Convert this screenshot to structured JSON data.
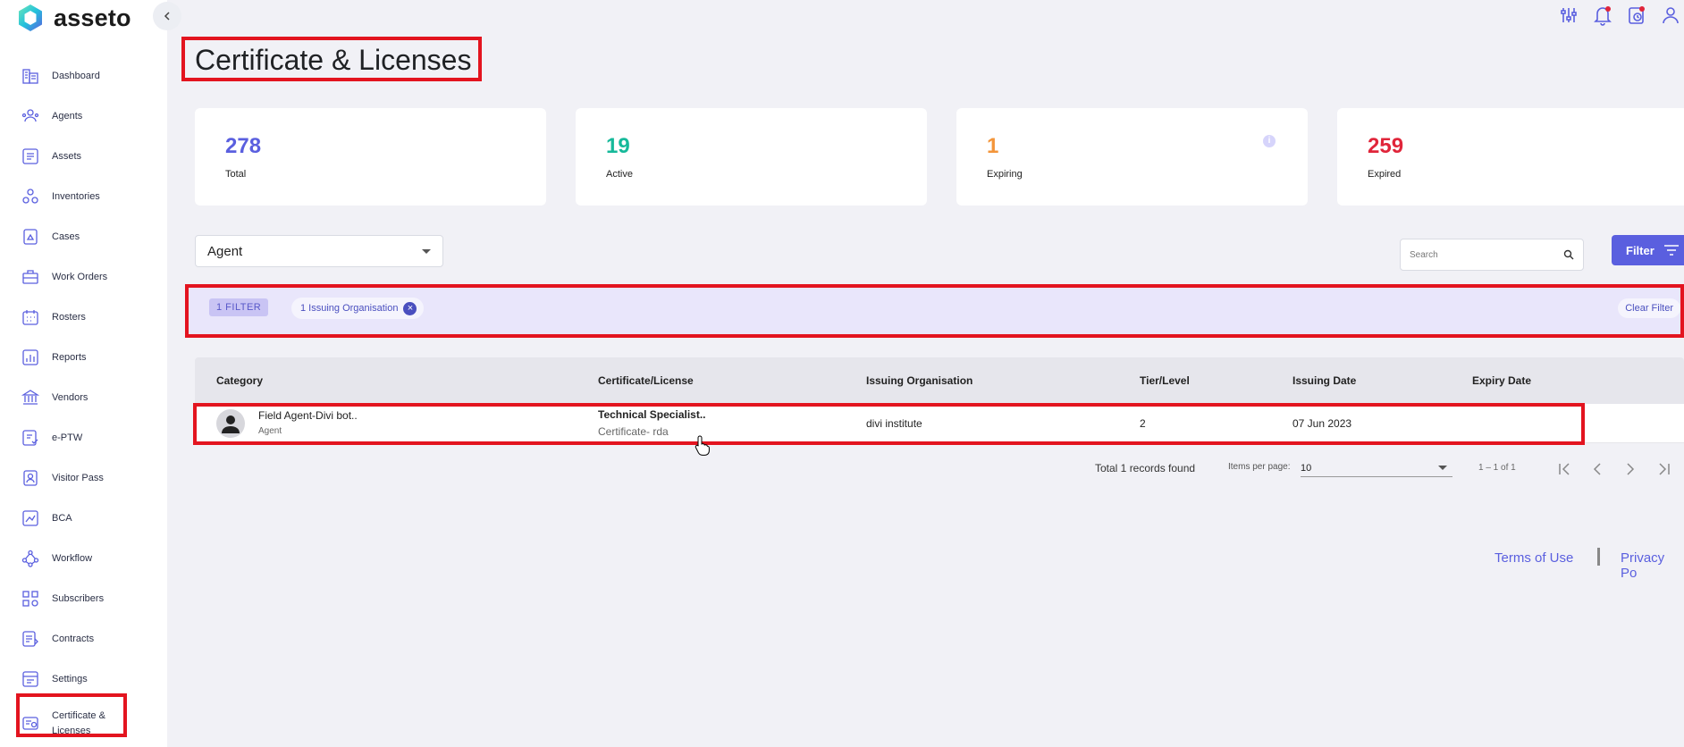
{
  "app": {
    "name": "asseto"
  },
  "sidebar": {
    "items": [
      {
        "label": "Dashboard",
        "icon": "building-icon"
      },
      {
        "label": "Agents",
        "icon": "agents-icon"
      },
      {
        "label": "Assets",
        "icon": "assets-icon"
      },
      {
        "label": "Inventories",
        "icon": "inventories-icon"
      },
      {
        "label": "Cases",
        "icon": "cases-icon"
      },
      {
        "label": "Work Orders",
        "icon": "toolbox-icon"
      },
      {
        "label": "Rosters",
        "icon": "calendar-icon"
      },
      {
        "label": "Reports",
        "icon": "bar-chart-icon"
      },
      {
        "label": "Vendors",
        "icon": "bank-icon"
      },
      {
        "label": "e-PTW",
        "icon": "permit-icon"
      },
      {
        "label": "Visitor Pass",
        "icon": "badge-icon"
      },
      {
        "label": "BCA",
        "icon": "bca-icon"
      },
      {
        "label": "Workflow",
        "icon": "workflow-icon"
      },
      {
        "label": "Subscribers",
        "icon": "grid-icon"
      },
      {
        "label": "Contracts",
        "icon": "contract-icon"
      },
      {
        "label": "Settings",
        "icon": "settings-icon"
      },
      {
        "label": "Certificate & Licenses",
        "icon": "certificate-icon"
      }
    ]
  },
  "header": {
    "title": "Certificate & Licenses"
  },
  "stats": [
    {
      "value": "278",
      "label": "Total",
      "color": "#5a5fdf"
    },
    {
      "value": "19",
      "label": "Active",
      "color": "#16b99a"
    },
    {
      "value": "1",
      "label": "Expiring",
      "color": "#f3953a"
    },
    {
      "value": "259",
      "label": "Expired",
      "color": "#e0253a"
    }
  ],
  "controls": {
    "category_select": "Agent",
    "search_placeholder": "Search",
    "filter_label": "Filter"
  },
  "filter_bar": {
    "count_label": "1 FILTER",
    "chip_label": "1 Issuing Organisation",
    "clear_label": "Clear Filter"
  },
  "table": {
    "columns": [
      "Category",
      "Certificate/License",
      "Issuing Organisation",
      "Tier/Level",
      "Issuing Date",
      "Expiry Date"
    ],
    "rows": [
      {
        "category": "Field Agent-Divi bot..",
        "category_sub": "Agent",
        "certificate": "Technical Specialist..",
        "certificate_sub": "Certificate- rda",
        "issuing_org": "divi institute",
        "tier": "2",
        "issuing_date": "07 Jun 2023",
        "expiry_date": ""
      }
    ]
  },
  "pagination": {
    "total_text": "Total 1 records found",
    "items_per_page_label": "Items per page:",
    "items_per_page": "10",
    "range": "1 – 1 of 1"
  },
  "footer": {
    "terms": "Terms of Use",
    "privacy": "Privacy Po"
  }
}
